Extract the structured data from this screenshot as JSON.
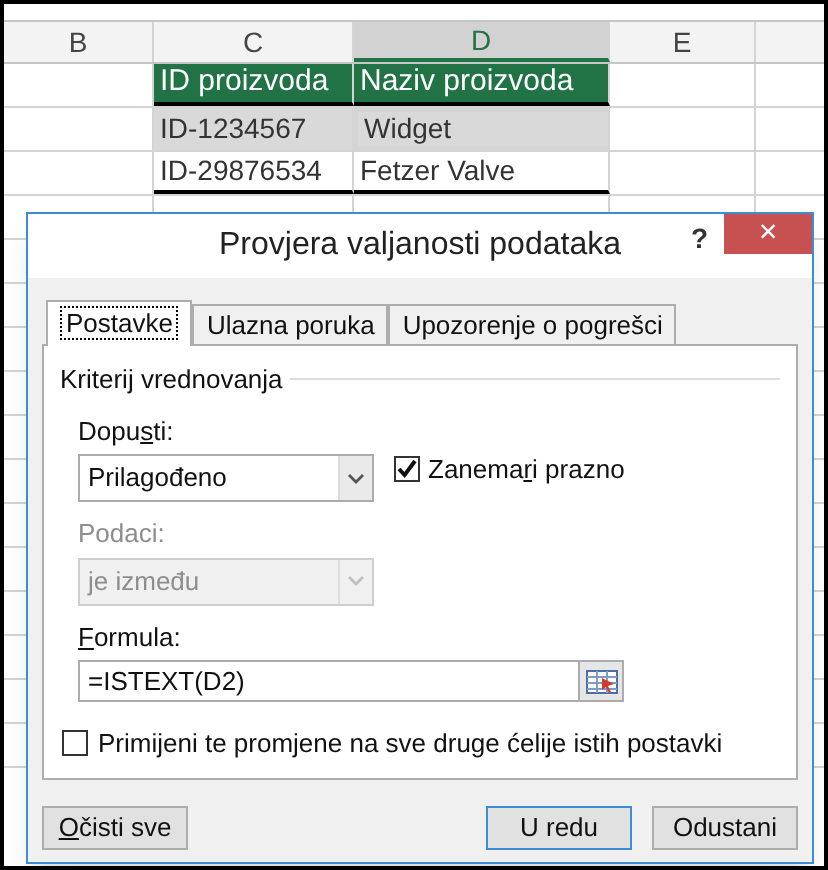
{
  "sheet": {
    "columns": [
      {
        "label": "B",
        "selected": false
      },
      {
        "label": "C",
        "selected": false
      },
      {
        "label": "D",
        "selected": true
      },
      {
        "label": "E",
        "selected": false
      }
    ],
    "rows": [
      {
        "cells": [
          null,
          {
            "text": "ID proizvoda",
            "kind": "header"
          },
          {
            "text": "Naziv proizvoda",
            "kind": "header"
          }
        ]
      },
      {
        "cells": [
          null,
          {
            "text": "ID-1234567",
            "kind": "shaded"
          },
          {
            "text": "Widget",
            "kind": "active"
          }
        ]
      },
      {
        "cells": [
          null,
          {
            "text": "ID-29876534",
            "kind": "plain"
          },
          {
            "text": "Fetzer Valve",
            "kind": "plain"
          }
        ]
      }
    ]
  },
  "dialog": {
    "title": "Provjera valjanosti podataka",
    "help": "?",
    "close": "×",
    "tabs": [
      {
        "label": "Postavke",
        "selected": true
      },
      {
        "label": "Ulazna poruka",
        "selected": false
      },
      {
        "label": "Upozorenje o pogrešci",
        "selected": false
      }
    ],
    "group_title": "Kriterij vrednovanja",
    "allow": {
      "label": {
        "before": "Dopu",
        "key": "s",
        "after": "ti:"
      },
      "value": "Prilagođeno",
      "disabled": false
    },
    "ignore_blank": {
      "label": {
        "before": "Zanema",
        "key": "r",
        "after": "i prazno"
      },
      "checked": true
    },
    "data": {
      "label": {
        "before": "Podaci:"
      },
      "value": "je između",
      "disabled": true
    },
    "formula": {
      "label": {
        "key": "F",
        "after": "ormula:"
      },
      "value": "=ISTEXT(D2)"
    },
    "apply_all": {
      "label": "Primijeni te promjene na sve druge ćelije istih postavki",
      "checked": false
    },
    "buttons": [
      {
        "label": {
          "key": "O",
          "after": "čisti sve"
        },
        "kind": "clear",
        "default": false
      },
      {
        "label": {
          "before": "U redu"
        },
        "kind": "ok",
        "default": true
      },
      {
        "label": {
          "before": "Odustani"
        },
        "kind": "cancel",
        "default": false
      }
    ]
  }
}
